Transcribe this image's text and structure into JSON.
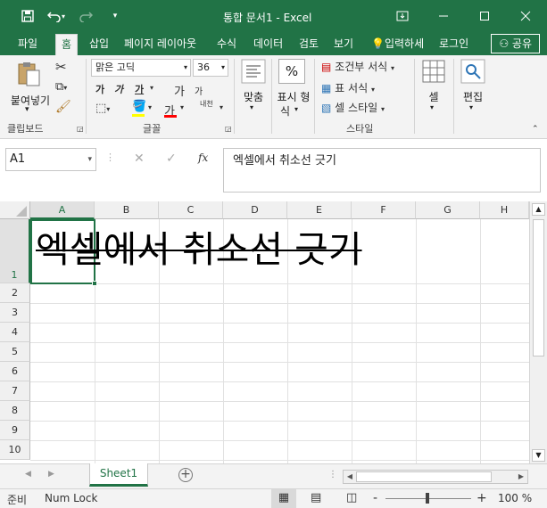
{
  "window": {
    "title": "통합 문서1 - Excel"
  },
  "tabs": [
    "파일",
    "홈",
    "삽입",
    "페이지 레이아웃",
    "수식",
    "데이터",
    "검토",
    "보기"
  ],
  "tell_me": "입력하세",
  "login": "로그인",
  "share": "공유",
  "clipboard": {
    "paste": "붙여넣기",
    "label": "클립보드"
  },
  "font": {
    "name": "맑은 고딕",
    "size": "36",
    "bold": "가",
    "italic": "가",
    "underline": "가",
    "grow": "가",
    "shrink": "가",
    "label": "글꼴",
    "color_glyph": "가",
    "phonetic": "내천"
  },
  "alignment": {
    "label": "맞춤"
  },
  "number": {
    "label1": "표시 형",
    "label2": "식",
    "symbol": "%"
  },
  "styles": {
    "conditional": "조건부 서식",
    "table": "표 서식",
    "cell": "셀 스타일",
    "label": "스타일"
  },
  "cells": {
    "label": "셀"
  },
  "editing": {
    "label": "편집"
  },
  "namebox": "A1",
  "formula": {
    "fx": "fx",
    "content": "엑셀에서 취소선 긋기"
  },
  "columns": [
    "A",
    "B",
    "C",
    "D",
    "E",
    "F",
    "G",
    "H"
  ],
  "rows": [
    "1",
    "2",
    "3",
    "4",
    "5",
    "6",
    "7",
    "8",
    "9",
    "10"
  ],
  "cell_a1": "엑셀에서 취소선 긋기",
  "sheet": {
    "name": "Sheet1"
  },
  "status": {
    "ready": "준비",
    "numlock": "Num Lock",
    "zoom": "100 %",
    "minus": "-",
    "plus": "+"
  },
  "colors": {
    "accent": "#217346",
    "fill": "#ffff00",
    "fontcolor": "#ff0000"
  }
}
